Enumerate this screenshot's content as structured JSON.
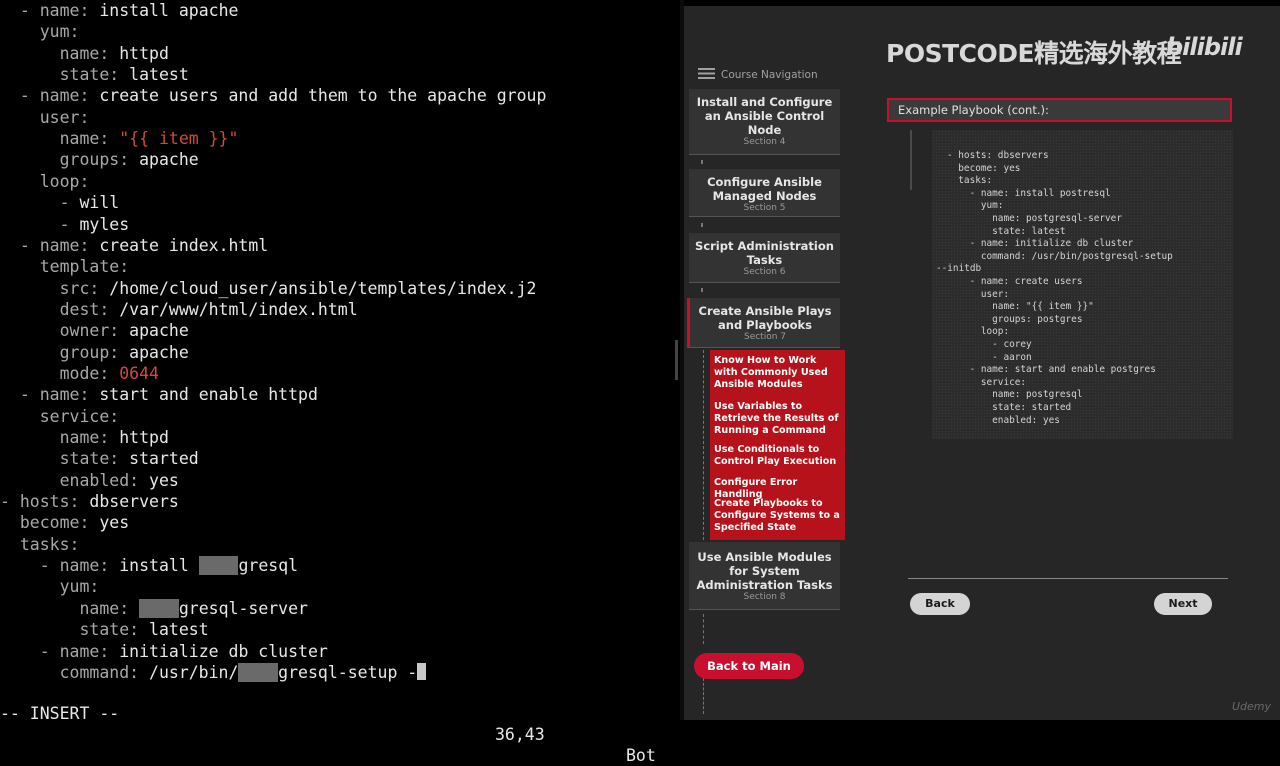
{
  "editor": {
    "lines": [
      {
        "indent": "  ",
        "parts": [
          [
            "k",
            "- "
          ],
          [
            "k",
            "name: "
          ],
          [
            "",
            "install apache"
          ]
        ]
      },
      {
        "indent": "    ",
        "parts": [
          [
            "k",
            "yum:"
          ]
        ]
      },
      {
        "indent": "      ",
        "parts": [
          [
            "k",
            "name: "
          ],
          [
            "",
            "httpd"
          ]
        ]
      },
      {
        "indent": "      ",
        "parts": [
          [
            "k",
            "state: "
          ],
          [
            "",
            "latest"
          ]
        ]
      },
      {
        "indent": "  ",
        "parts": [
          [
            "k",
            "- "
          ],
          [
            "k",
            "name: "
          ],
          [
            "",
            "create users and add them to the apache group"
          ]
        ]
      },
      {
        "indent": "    ",
        "parts": [
          [
            "k",
            "user:"
          ]
        ]
      },
      {
        "indent": "      ",
        "parts": [
          [
            "k",
            "name: "
          ],
          [
            "s",
            "\"{{ item }}\""
          ]
        ]
      },
      {
        "indent": "      ",
        "parts": [
          [
            "k",
            "groups: "
          ],
          [
            "",
            "apache"
          ]
        ]
      },
      {
        "indent": "    ",
        "parts": [
          [
            "k",
            "loop:"
          ]
        ]
      },
      {
        "indent": "      ",
        "parts": [
          [
            "k",
            "- "
          ],
          [
            "",
            "will"
          ]
        ]
      },
      {
        "indent": "      ",
        "parts": [
          [
            "k",
            "- "
          ],
          [
            "",
            "myles"
          ]
        ]
      },
      {
        "indent": "  ",
        "parts": [
          [
            "k",
            "- "
          ],
          [
            "k",
            "name: "
          ],
          [
            "",
            "create index.html"
          ]
        ]
      },
      {
        "indent": "    ",
        "parts": [
          [
            "k",
            "template:"
          ]
        ]
      },
      {
        "indent": "      ",
        "parts": [
          [
            "k",
            "src: "
          ],
          [
            "",
            "/home/cloud_user/ansible/templates/index.j2"
          ]
        ]
      },
      {
        "indent": "      ",
        "parts": [
          [
            "k",
            "dest: "
          ],
          [
            "",
            "/var/www/html/index.html"
          ]
        ]
      },
      {
        "indent": "      ",
        "parts": [
          [
            "k",
            "owner: "
          ],
          [
            "",
            "apache"
          ]
        ]
      },
      {
        "indent": "      ",
        "parts": [
          [
            "k",
            "group: "
          ],
          [
            "",
            "apache"
          ]
        ]
      },
      {
        "indent": "      ",
        "parts": [
          [
            "k",
            "mode: "
          ],
          [
            "s",
            "0644"
          ]
        ]
      },
      {
        "indent": "  ",
        "parts": [
          [
            "k",
            "- "
          ],
          [
            "k",
            "name: "
          ],
          [
            "",
            "start and enable httpd"
          ]
        ]
      },
      {
        "indent": "    ",
        "parts": [
          [
            "k",
            "service:"
          ]
        ]
      },
      {
        "indent": "      ",
        "parts": [
          [
            "k",
            "name: "
          ],
          [
            "",
            "httpd"
          ]
        ]
      },
      {
        "indent": "      ",
        "parts": [
          [
            "k",
            "state: "
          ],
          [
            "",
            "started"
          ]
        ]
      },
      {
        "indent": "      ",
        "parts": [
          [
            "k",
            "enabled: "
          ],
          [
            "",
            "yes"
          ]
        ]
      },
      {
        "indent": "",
        "parts": [
          [
            "k",
            "- "
          ],
          [
            "k",
            "hosts: "
          ],
          [
            "",
            "dbservers"
          ]
        ]
      },
      {
        "indent": "  ",
        "parts": [
          [
            "k",
            "become: "
          ],
          [
            "",
            "yes"
          ]
        ]
      },
      {
        "indent": "  ",
        "parts": [
          [
            "k",
            "tasks:"
          ]
        ]
      },
      {
        "indent": "    ",
        "parts": [
          [
            "k",
            "- "
          ],
          [
            "k",
            "name: "
          ],
          [
            "",
            "install "
          ],
          [
            "r",
            "post"
          ],
          [
            "",
            "gresql"
          ]
        ]
      },
      {
        "indent": "      ",
        "parts": [
          [
            "k",
            "yum:"
          ]
        ]
      },
      {
        "indent": "        ",
        "parts": [
          [
            "k",
            "name: "
          ],
          [
            "r",
            "post"
          ],
          [
            "",
            "gresql-server"
          ]
        ]
      },
      {
        "indent": "        ",
        "parts": [
          [
            "k",
            "state: "
          ],
          [
            "",
            "latest"
          ]
        ]
      },
      {
        "indent": "    ",
        "parts": [
          [
            "k",
            "- "
          ],
          [
            "k",
            "name: "
          ],
          [
            "",
            "initialize db cluster"
          ]
        ]
      },
      {
        "indent": "      ",
        "parts": [
          [
            "k",
            "command: "
          ],
          [
            "",
            "/usr/bin/"
          ],
          [
            "r",
            "post"
          ],
          [
            "",
            "gresql-setup -"
          ]
        ]
      }
    ],
    "status_mode": "-- INSERT --",
    "status_pos": "36,43",
    "status_pct": "Bot"
  },
  "brand": {
    "watermark": "POSTCODE精选海外教程",
    "logo": "bilibili",
    "footer": "Udemy"
  },
  "nav": {
    "header": "Course Navigation",
    "sections": [
      {
        "title": "Install and Configure an Ansible Control Node",
        "sub": "Section 4"
      },
      {
        "title": "Configure Ansible Managed Nodes",
        "sub": "Section 5"
      },
      {
        "title": "Script Administration Tasks",
        "sub": "Section 6"
      },
      {
        "title": "Create Ansible Plays and Playbooks",
        "sub": "Section 7"
      },
      {
        "title": "Use Ansible Modules for System Administration Tasks",
        "sub": "Section 8"
      }
    ],
    "subitems": [
      "Know How to Work with Commonly Used Ansible Modules",
      "Use Variables to Retrieve the Results of Running a Command",
      "Use Conditionals to Control Play Execution",
      "Configure Error Handling",
      "Create Playbooks to Configure Systems to a Specified State"
    ],
    "back_main": "Back to Main"
  },
  "content": {
    "title": "Example Playbook (cont.):",
    "code": [
      "- hosts: dbservers",
      "  become: yes",
      "  tasks:",
      "    - name: install postresql",
      "      yum:",
      "        name: postgresql-server",
      "        state: latest",
      "    - name: initialize db cluster",
      "      command: /usr/bin/postgresql-setup",
      "--initdb",
      "    - name: create users",
      "      user:",
      "        name: \"{{ item }}\"",
      "        groups: postgres",
      "      loop:",
      "        - corey",
      "        - aaron",
      "    - name: start and enable postgres",
      "      service:",
      "        name: postgresql",
      "        state: started",
      "        enabled: yes"
    ],
    "back_label": "Back",
    "next_label": "Next"
  }
}
